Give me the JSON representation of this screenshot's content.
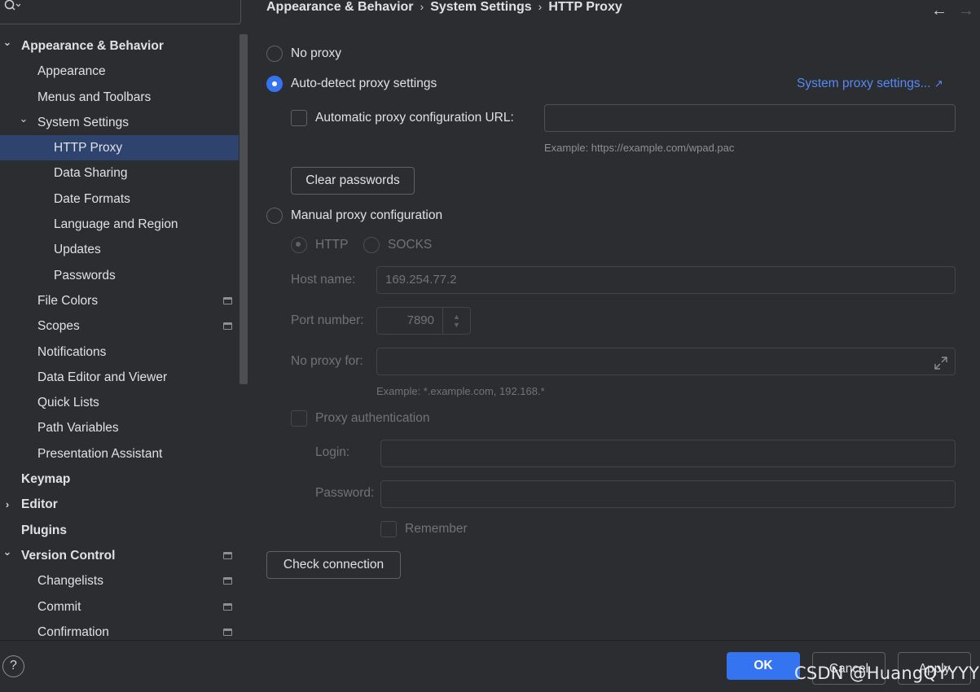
{
  "sidebar": {
    "items": [
      {
        "label": "Appearance & Behavior",
        "level": 0,
        "bold": true,
        "chevron": "chevron-down-icon",
        "expanded": true
      },
      {
        "label": "Appearance",
        "level": 1
      },
      {
        "label": "Menus and Toolbars",
        "level": 1
      },
      {
        "label": "System Settings",
        "level": 1,
        "chevron": "chevron-down-icon",
        "expanded": true
      },
      {
        "label": "HTTP Proxy",
        "level": 2,
        "selected": true
      },
      {
        "label": "Data Sharing",
        "level": 2
      },
      {
        "label": "Date Formats",
        "level": 2
      },
      {
        "label": "Language and Region",
        "level": 2
      },
      {
        "label": "Updates",
        "level": 2
      },
      {
        "label": "Passwords",
        "level": 2
      },
      {
        "label": "File Colors",
        "level": 1,
        "badge": true
      },
      {
        "label": "Scopes",
        "level": 1,
        "badge": true
      },
      {
        "label": "Notifications",
        "level": 1
      },
      {
        "label": "Data Editor and Viewer",
        "level": 1
      },
      {
        "label": "Quick Lists",
        "level": 1
      },
      {
        "label": "Path Variables",
        "level": 1
      },
      {
        "label": "Presentation Assistant",
        "level": 1
      },
      {
        "label": "Keymap",
        "level": 0,
        "bold": true
      },
      {
        "label": "Editor",
        "level": 0,
        "bold": true,
        "chevron": "chevron-right-icon",
        "expanded": false
      },
      {
        "label": "Plugins",
        "level": 0,
        "bold": true
      },
      {
        "label": "Version Control",
        "level": 0,
        "bold": true,
        "chevron": "chevron-down-icon",
        "expanded": true,
        "badge": true
      },
      {
        "label": "Changelists",
        "level": 1,
        "badge": true
      },
      {
        "label": "Commit",
        "level": 1,
        "badge": true
      },
      {
        "label": "Confirmation",
        "level": 1,
        "badge": true
      }
    ]
  },
  "header": {
    "breadcrumb": [
      "Appearance & Behavior",
      "System Settings",
      "HTTP Proxy"
    ]
  },
  "proxy": {
    "no_proxy_label": "No proxy",
    "auto_detect_label": "Auto-detect proxy settings",
    "system_proxy_link": "System proxy settings...",
    "auto_config_url_label": "Automatic proxy configuration URL:",
    "auto_config_url_value": "",
    "auto_config_example": "Example: https://example.com/wpad.pac",
    "clear_passwords_label": "Clear passwords",
    "manual_label": "Manual proxy configuration",
    "http_label": "HTTP",
    "socks_label": "SOCKS",
    "host_name_label": "Host name:",
    "host_name_value": "169.254.77.2",
    "port_number_label": "Port number:",
    "port_number_value": "7890",
    "no_proxy_for_label": "No proxy for:",
    "no_proxy_for_value": "",
    "no_proxy_for_example": "Example: *.example.com, 192.168.*",
    "proxy_auth_label": "Proxy authentication",
    "login_label": "Login:",
    "login_value": "",
    "password_label": "Password:",
    "password_value": "",
    "remember_label": "Remember",
    "check_connection_label": "Check connection",
    "selected_mode": "auto-detect"
  },
  "footer": {
    "help_label": "?",
    "ok_label": "OK",
    "cancel_label": "Cancel",
    "apply_label": "Apply",
    "watermark": "CSDN @HuangQYYYY"
  },
  "colors": {
    "accent": "#3574f0",
    "selection": "#2e436e",
    "link": "#548af7",
    "background": "#2b2d30"
  }
}
